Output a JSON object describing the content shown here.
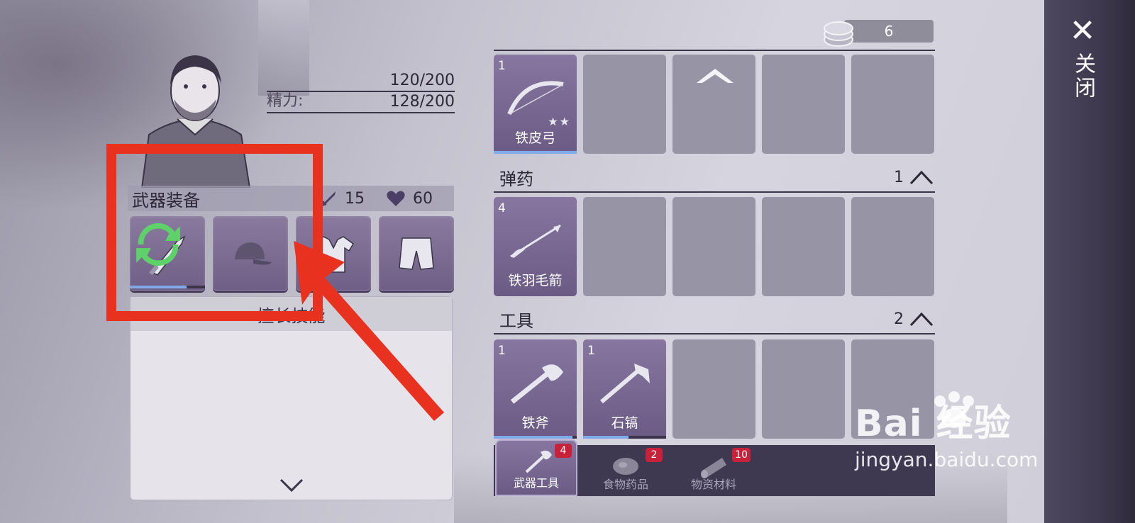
{
  "close": {
    "label": "关闭"
  },
  "character": {
    "stats": [
      {
        "label": "",
        "value": "120/200"
      },
      {
        "label": "精力:",
        "value": "128/200"
      }
    ]
  },
  "equipment": {
    "title": "武器装备",
    "attack": "15",
    "health": "60",
    "slots": [
      {
        "name": "knife",
        "durability": 0.75
      },
      {
        "name": "cap"
      },
      {
        "name": "shirt"
      },
      {
        "name": "shorts"
      }
    ],
    "skill_title": "擅长技能"
  },
  "currency": {
    "amount": "6"
  },
  "inventory": {
    "weapons": {
      "items": [
        {
          "qty": "1",
          "name": "铁皮弓",
          "stars": "★★"
        }
      ]
    },
    "ammo": {
      "title": "弹药",
      "count": "1",
      "items": [
        {
          "qty": "4",
          "name": "铁羽毛箭"
        }
      ]
    },
    "tools": {
      "title": "工具",
      "count": "2",
      "items": [
        {
          "qty": "1",
          "name": "铁斧"
        },
        {
          "qty": "1",
          "name": "石镐"
        }
      ]
    }
  },
  "tabs": [
    {
      "label": "武器工具",
      "badge": "4"
    },
    {
      "label": "食物药品",
      "badge": "2"
    },
    {
      "label": "物资材料",
      "badge": "10"
    }
  ],
  "watermark": {
    "brand": "Bai  经验",
    "url": "jingyan.baidu.com"
  },
  "colors": {
    "annotation": "#e8321f",
    "accent": "#7b6a96",
    "badge": "#c8223a"
  }
}
